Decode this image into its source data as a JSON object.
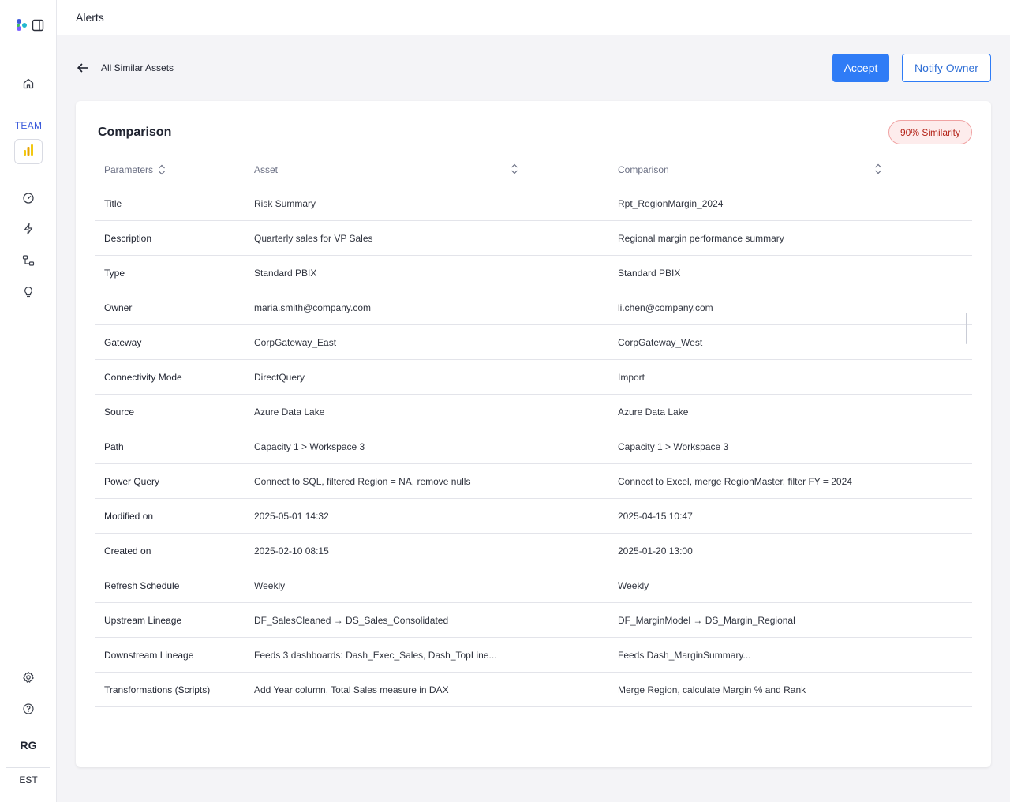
{
  "header": {
    "title": "Alerts"
  },
  "sidebar": {
    "icons": [
      "home-icon",
      "dashboard-gauge-icon",
      "lightning-icon",
      "lineage-icon",
      "lightbulb-icon",
      "gear-icon",
      "help-icon"
    ],
    "team_label": "TEAM",
    "user_initials": "RG",
    "timezone": "EST"
  },
  "nav": {
    "back_label": "All Similar Assets"
  },
  "actions": {
    "accept_label": "Accept",
    "notify_label": "Notify Owner"
  },
  "comparison": {
    "title": "Comparison",
    "similarity": "90% Similarity",
    "columns": [
      "Parameters",
      "Asset",
      "Comparison"
    ],
    "rows": [
      [
        "Title",
        "Risk Summary",
        "Rpt_RegionMargin_2024"
      ],
      [
        "Description",
        "Quarterly sales for VP Sales",
        "Regional margin performance summary"
      ],
      [
        "Type",
        "Standard PBIX",
        "Standard PBIX"
      ],
      [
        "Owner",
        "maria.smith@company.com",
        "li.chen@company.com"
      ],
      [
        "Gateway",
        "CorpGateway_East",
        "CorpGateway_West"
      ],
      [
        "Connectivity Mode",
        "DirectQuery",
        "Import"
      ],
      [
        "Source",
        "Azure Data Lake",
        "Azure Data Lake"
      ],
      [
        "Path",
        "Capacity 1 > Workspace 3",
        "Capacity 1 > Workspace 3"
      ],
      [
        "Power Query",
        "Connect to SQL, filtered Region = NA, remove nulls",
        "Connect to Excel, merge RegionMaster, filter FY = 2024"
      ],
      [
        "Modified on",
        "2025-05-01 14:32",
        "2025-04-15 10:47"
      ],
      [
        "Created on",
        "2025-02-10 08:15",
        "2025-01-20 13:00"
      ],
      [
        "Refresh Schedule",
        "Weekly",
        "Weekly"
      ],
      [
        "Upstream Lineage",
        "DF_SalesCleaned → DS_Sales_Consolidated",
        "DF_MarginModel → DS_Margin_Regional"
      ],
      [
        "Downstream Lineage",
        "Feeds 3 dashboards: Dash_Exec_Sales, Dash_TopLine...",
        "Feeds Dash_MarginSummary..."
      ],
      [
        "Transformations (Scripts)",
        "Add Year column, Total Sales measure in DAX",
        "Merge Region, calculate Margin % and Rank"
      ]
    ]
  },
  "colors": {
    "accent": "#2f7cf6",
    "badge_text": "#b42318",
    "badge_bg": "#fdecec"
  }
}
